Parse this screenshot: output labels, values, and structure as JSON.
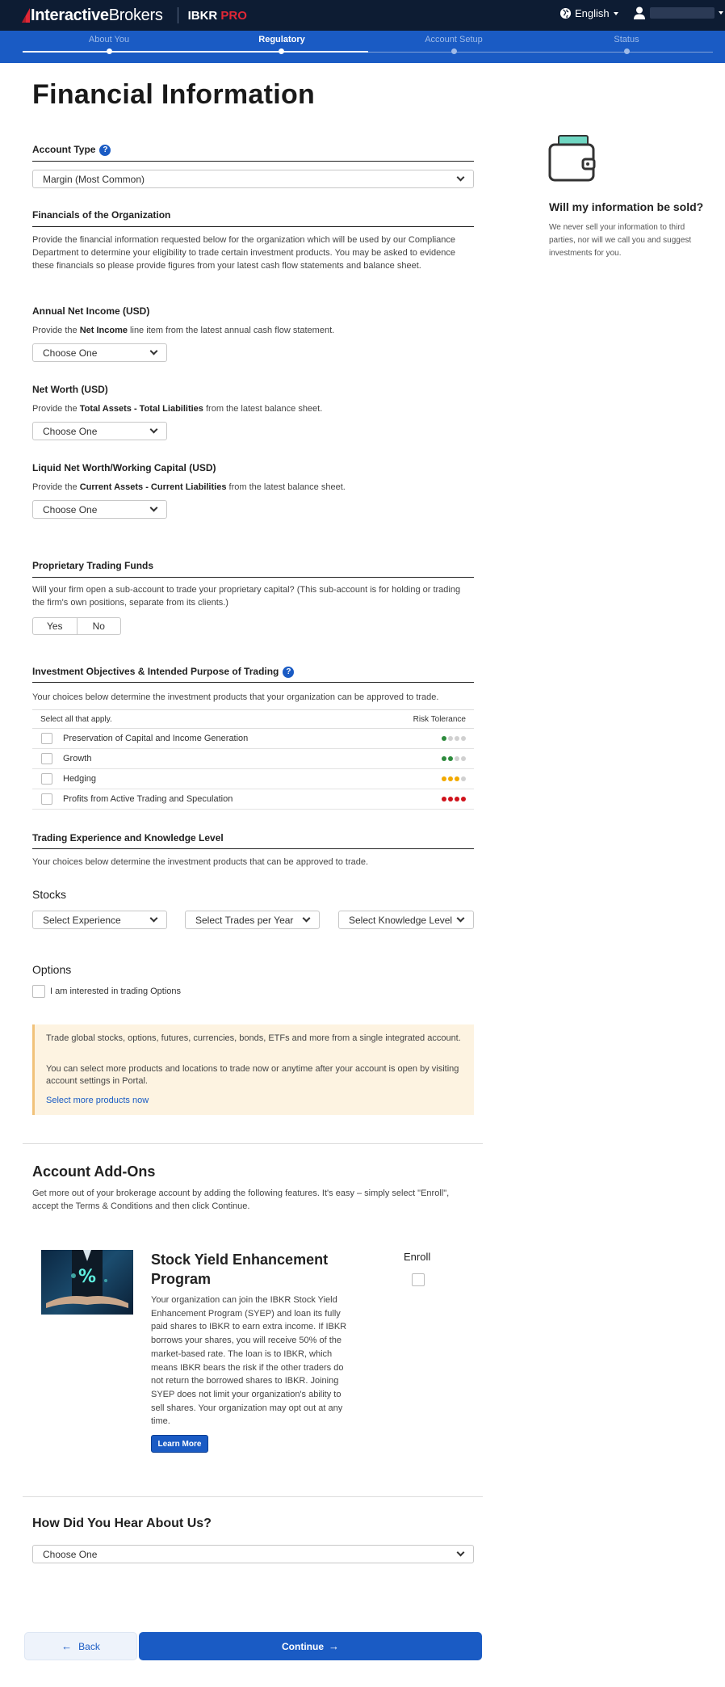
{
  "header": {
    "brand_bold": "Interactive",
    "brand_rest": "Brokers",
    "product": "IBKR",
    "product_accent": "PRO",
    "language": "English"
  },
  "steps": [
    {
      "label": "About You",
      "state": "done"
    },
    {
      "label": "Regulatory",
      "state": "active"
    },
    {
      "label": "Account Setup",
      "state": "pending"
    },
    {
      "label": "Status",
      "state": "pending"
    }
  ],
  "page_title": "Financial Information",
  "account_type": {
    "label": "Account Type",
    "help": "?",
    "value": "Margin (Most Common)"
  },
  "financials": {
    "title": "Financials of the Organization",
    "intro": "Provide the financial information requested below for the organization which will be used by our Compliance Department to determine your eligibility to trade certain investment products. You may be asked to evidence these financials so please provide figures from your latest cash flow statements and balance sheet.",
    "net_income": {
      "label": "Annual Net Income (USD)",
      "pre": "Provide the ",
      "bold": "Net Income",
      "post": " line item from the latest annual cash flow statement.",
      "value": "Choose One"
    },
    "net_worth": {
      "label": "Net Worth (USD)",
      "pre": "Provide the ",
      "bold": "Total Assets - Total Liabilities",
      "post": " from the latest balance sheet.",
      "value": "Choose One"
    },
    "liquid": {
      "label": "Liquid Net Worth/Working Capital (USD)",
      "pre": "Provide the ",
      "bold": "Current Assets - Current Liabilities",
      "post": " from the latest balance sheet.",
      "value": "Choose One"
    }
  },
  "prop_trading": {
    "title": "Proprietary Trading Funds",
    "question": "Will your firm open a sub-account to trade your proprietary capital? (This sub-account is for holding or trading the firm's own positions, separate from its clients.)",
    "yes": "Yes",
    "no": "No"
  },
  "objectives": {
    "title": "Investment Objectives & Intended Purpose of Trading",
    "help": "?",
    "intro": "Your choices below determine the investment products that your organization can be approved to trade.",
    "col_left": "Select all that apply.",
    "col_right": "Risk Tolerance",
    "rows": [
      {
        "label": "Preservation of Capital and Income Generation",
        "risk": 1,
        "color": "#2e8b3d"
      },
      {
        "label": "Growth",
        "risk": 2,
        "color": "#2e8b3d"
      },
      {
        "label": "Hedging",
        "risk": 3,
        "color": "#f2a900"
      },
      {
        "label": "Profits from Active Trading and Speculation",
        "risk": 4,
        "color": "#d0121b"
      }
    ]
  },
  "experience": {
    "title": "Trading Experience and Knowledge Level",
    "intro": "Your choices below determine the investment products that can be approved to trade.",
    "stocks_label": "Stocks",
    "sel_experience": "Select Experience",
    "sel_trades": "Select Trades per Year",
    "sel_knowledge": "Select Knowledge Level",
    "options_label": "Options",
    "options_check": "I am interested in trading Options"
  },
  "notice": {
    "p1": "Trade global stocks, options, futures, currencies, bonds, ETFs and more from a single integrated account.",
    "p2": "You can select more products and locations to trade now or anytime after your account is open by visiting account settings in Portal.",
    "link": "Select more products now"
  },
  "addons": {
    "title": "Account Add-Ons",
    "intro": "Get more out of your brokerage account by adding the following features. It's easy – simply select \"Enroll\", accept the Terms & Conditions and then click Continue.",
    "program_title": "Stock Yield Enhancement Program",
    "program_desc": "Your organization can join the IBKR Stock Yield Enhancement Program (SYEP) and loan its fully paid shares to IBKR to earn extra income. If IBKR borrows your shares, you will receive 50% of the market-based rate. The loan is to IBKR, which means IBKR bears the risk if the other traders do not return the borrowed shares to IBKR. Joining SYEP does not limit your organization's ability to sell shares. Your organization may opt out at any time.",
    "learn_more": "Learn More",
    "enroll": "Enroll",
    "img_symbol": "%"
  },
  "hear": {
    "title": "How Did You Hear About Us?",
    "value": "Choose One"
  },
  "sidebar": {
    "title": "Will my information be sold?",
    "body": "We never sell your information to third parties, nor will we call you and suggest investments for you."
  },
  "footer": {
    "back": "Back",
    "continue": "Continue"
  },
  "colors": {
    "brand_blue": "#1a5bc4",
    "navy": "#0d1c33",
    "accent_red": "#e02736"
  }
}
